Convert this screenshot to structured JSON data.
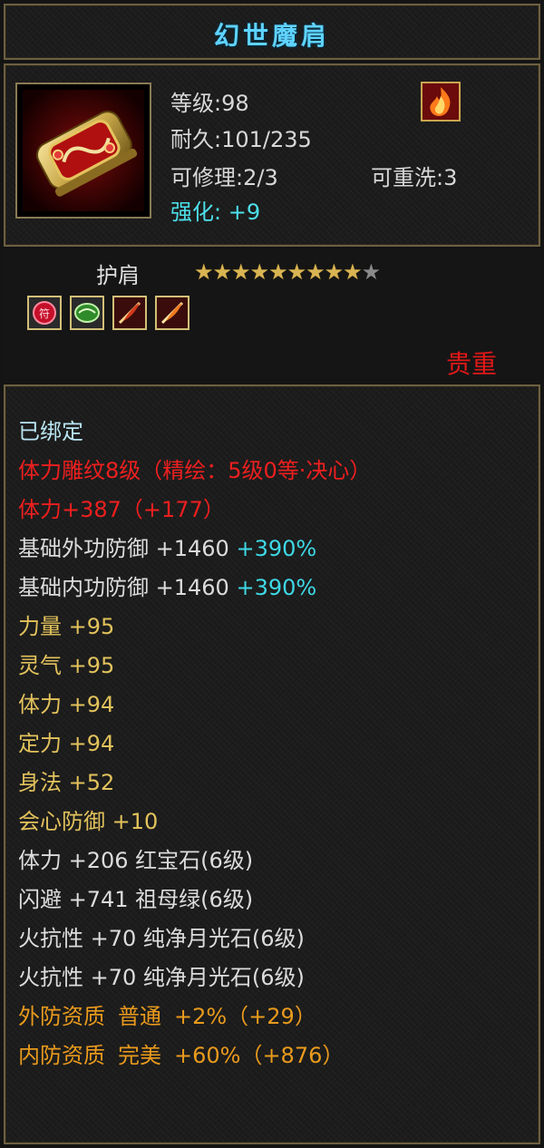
{
  "title": "幻世魔肩",
  "info": {
    "level_label": "等级:98",
    "durability_label": "耐久:101/235",
    "repair_label": "可修理:2/3",
    "rewash_label": "可重洗:3",
    "enhance_label": "强化: +9"
  },
  "item_type": "护肩",
  "stars": {
    "filled": "★★★★★★★★★★★",
    "empty": "★",
    "count_filled": 9,
    "count_total": 10
  },
  "rarity": "贵重",
  "attributes": {
    "bound": "已绑定",
    "engrave": "体力雕纹8级（精绘：5级0等·决心）",
    "stamina_main": "体力+387（+177）",
    "ext_def_label": "基础外功防御 +1460",
    "ext_def_pct": "+390%",
    "int_def_label": "基础内功防御 +1460",
    "int_def_pct": "+390%",
    "strength": "力量 +95",
    "spirit": "灵气 +95",
    "stamina": "体力 +94",
    "focus": "定力 +94",
    "agility": "身法 +52",
    "crit_def": "会心防御 +10",
    "gem1": "体力 +206 红宝石(6级)",
    "gem2": "闪避 +741 祖母绿(6级)",
    "gem3": "火抗性 +70 纯净月光石(6级)",
    "gem4": "火抗性 +70 纯净月光石(6级)",
    "ext_quality_a": "外防资质",
    "ext_quality_b": "普通",
    "ext_quality_c": "+2%（+29）",
    "int_quality_a": "内防资质",
    "int_quality_b": "完美",
    "int_quality_c": "+60%（+876）"
  },
  "sockets": [
    "ruby-gem-icon",
    "emerald-gem-icon",
    "feather-gem-icon",
    "feather-gem-icon"
  ],
  "colors": {
    "title": "#5fd3ff",
    "rarity": "#e01818",
    "enhance": "#4ce0ea",
    "engrave": "#ee1f1f",
    "stat": "#e2c25c",
    "quality": "#e99a1d"
  }
}
